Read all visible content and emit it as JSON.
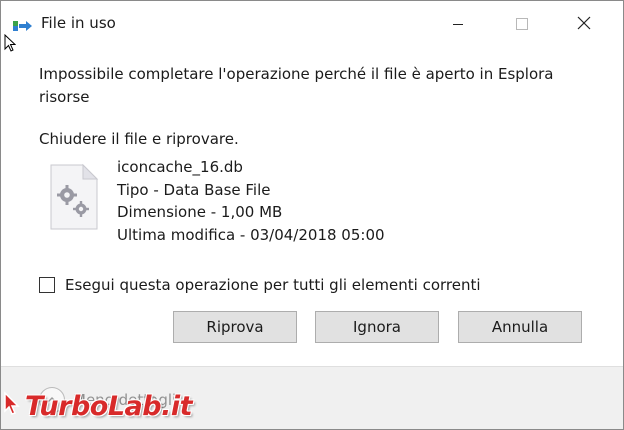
{
  "window": {
    "title": "File in uso",
    "app_icon": "file-transfer-icon",
    "controls": {
      "minimize_icon": "minimize-icon",
      "maximize_icon": "maximize-icon",
      "close_icon": "close-icon"
    }
  },
  "dialog": {
    "message": "Impossibile completare l'operazione perché il file è aperto in Esplora risorse",
    "instruction": "Chiudere il file e riprovare.",
    "file": {
      "icon": "settings-file-icon",
      "name": "iconcache_16.db",
      "type": "Tipo - Data Base File",
      "size": "Dimensione - 1,00 MB",
      "modified": "Ultima modifica - 03/04/2018 05:00"
    },
    "checkbox": {
      "label": "Esegui questa operazione per tutti gli elementi correnti",
      "checked": false
    },
    "buttons": {
      "retry": "Riprova",
      "ignore": "Ignora",
      "cancel": "Annulla"
    },
    "details_toggle": {
      "label": "Meno dettagli",
      "icon": "chevron-up-icon"
    }
  },
  "watermark": {
    "text": "TurboLab.it",
    "color": "#d82a2a"
  }
}
